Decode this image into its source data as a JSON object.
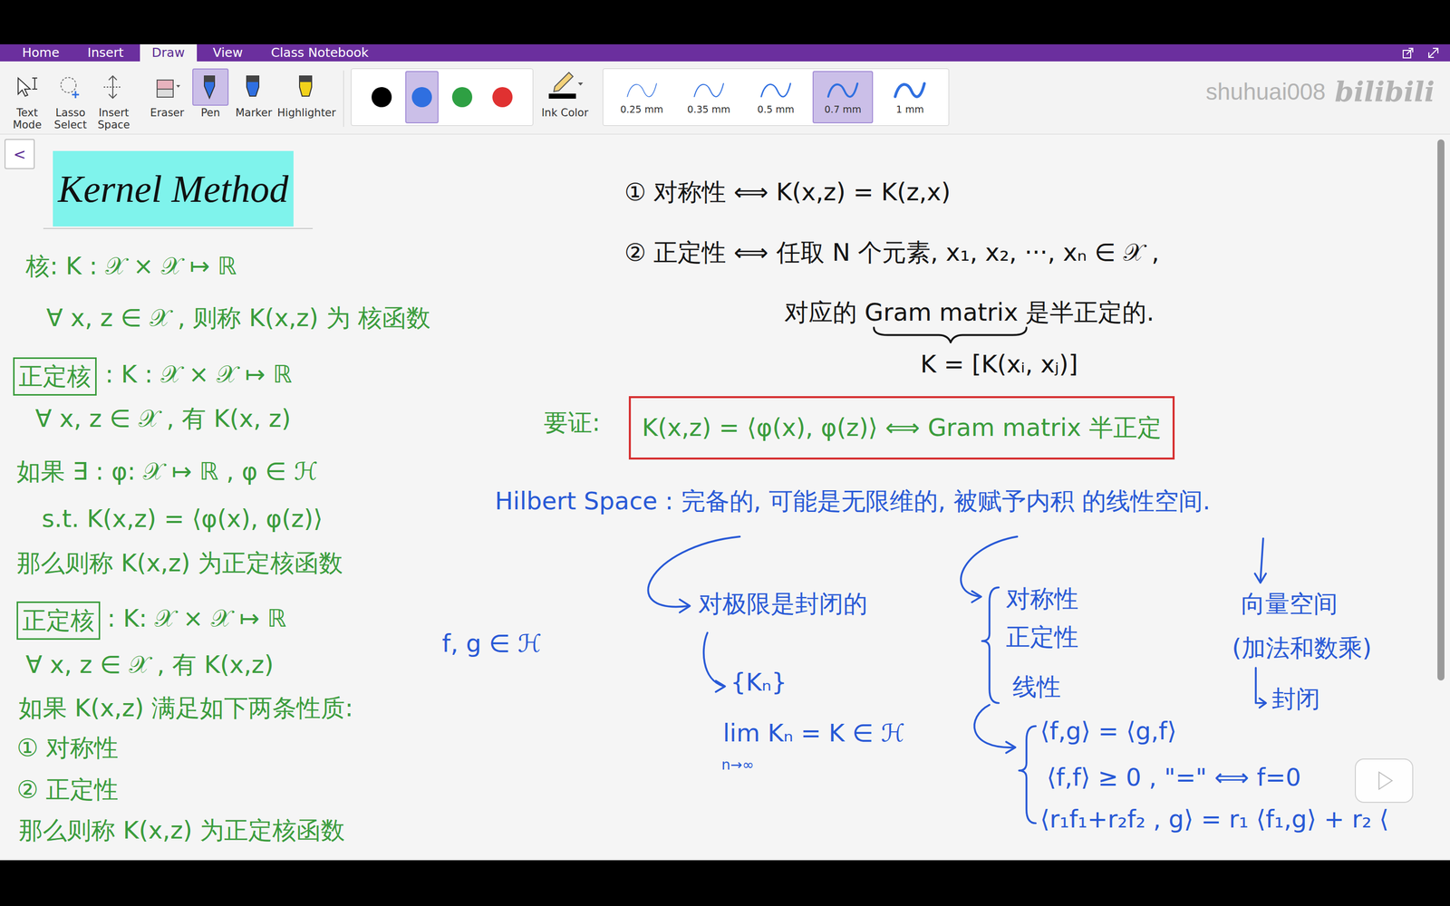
{
  "ribbon": {
    "tabs": [
      {
        "label": "Home",
        "selected": false
      },
      {
        "label": "Insert",
        "selected": false
      },
      {
        "label": "Draw",
        "selected": true
      },
      {
        "label": "View",
        "selected": false
      },
      {
        "label": "Class Notebook",
        "selected": false
      }
    ]
  },
  "toolbar": {
    "tools": [
      {
        "label": "Text Mode",
        "kind": "text-mode",
        "selected": false
      },
      {
        "label": "Lasso Select",
        "kind": "lasso",
        "selected": false
      },
      {
        "label": "Insert Space",
        "kind": "insert-space",
        "selected": false
      },
      {
        "label": "Eraser",
        "kind": "eraser",
        "selected": false
      },
      {
        "label": "Pen",
        "kind": "pen",
        "selected": true
      },
      {
        "label": "Marker",
        "kind": "marker",
        "selected": false
      },
      {
        "label": "Highlighter",
        "kind": "highlighter",
        "selected": false
      }
    ],
    "pen_colors": [
      {
        "color": "#000000",
        "selected": false
      },
      {
        "color": "#2f6fe0",
        "selected": true
      },
      {
        "color": "#2ea043",
        "selected": false
      },
      {
        "color": "#e03131",
        "selected": false
      }
    ],
    "ink_color": {
      "label": "Ink Color"
    },
    "thickness": [
      {
        "label": "0.25 mm",
        "selected": false
      },
      {
        "label": "0.35 mm",
        "selected": false
      },
      {
        "label": "0.5 mm",
        "selected": false
      },
      {
        "label": "0.7 mm",
        "selected": true
      },
      {
        "label": "1 mm",
        "selected": false
      }
    ]
  },
  "watermark": {
    "user": "shuhuai008",
    "site": "bilibili"
  },
  "page": {
    "back": "<",
    "title": "Kernel Method",
    "notes": [
      {
        "text": "核:  K : 𝒳 × 𝒳 ↦ ℝ",
        "color": "#3a9c3c",
        "kind": "text"
      },
      {
        "text": "∀ x, z ∈ 𝒳 , 则称 K(x,z) 为 核函数",
        "color": "#3a9c3c",
        "kind": "text"
      },
      {
        "text": "正定核",
        "color": "#3a9c3c",
        "kind": "boxed"
      },
      {
        "text": ": K : 𝒳 × 𝒳 ↦ ℝ",
        "color": "#3a9c3c",
        "kind": "text"
      },
      {
        "text": "∀ x, z ∈ 𝒳 , 有 K(x, z)",
        "color": "#3a9c3c",
        "kind": "text"
      },
      {
        "text": "如果 ∃ : φ: 𝒳 ↦ ℝ , φ ∈ ℋ",
        "color": "#3a9c3c",
        "kind": "text"
      },
      {
        "text": "s.t.  K(x,z) = ⟨φ(x), φ(z)⟩",
        "color": "#3a9c3c",
        "kind": "text"
      },
      {
        "text": "那么则称 K(x,z) 为正定核函数",
        "color": "#3a9c3c",
        "kind": "text"
      },
      {
        "text": "正定核",
        "color": "#3a9c3c",
        "kind": "boxed"
      },
      {
        "text": ": K: 𝒳 × 𝒳 ↦ ℝ",
        "color": "#3a9c3c",
        "kind": "text"
      },
      {
        "text": "∀ x, z ∈ 𝒳 , 有 K(x,z)",
        "color": "#3a9c3c",
        "kind": "text"
      },
      {
        "text": "如果 K(x,z) 满足如下两条性质:",
        "color": "#3a9c3c",
        "kind": "text"
      },
      {
        "text": "① 对称性",
        "color": "#3a9c3c",
        "kind": "text"
      },
      {
        "text": "② 正定性",
        "color": "#3a9c3c",
        "kind": "text"
      },
      {
        "text": "那么则称 K(x,z) 为正定核函数",
        "color": "#3a9c3c",
        "kind": "text"
      },
      {
        "text": "① 对称性 ⟺ K(x,z) = K(z,x)",
        "color": "#141414",
        "kind": "text"
      },
      {
        "text": "② 正定性 ⟺ 任取 N 个元素, x₁, x₂, ···, xₙ ∈ 𝒳 ,",
        "color": "#141414",
        "kind": "text"
      },
      {
        "text": "对应的 Gram matrix 是半正定的.",
        "color": "#141414",
        "kind": "text"
      },
      {
        "text": "K = [K(xᵢ, xⱼ)]",
        "color": "#141414",
        "kind": "text"
      },
      {
        "text": "要证:",
        "color": "#3a9c3c",
        "kind": "text"
      },
      {
        "text": "K(x,z) = ⟨φ(x), φ(z)⟩  ⟺  Gram matrix 半正定",
        "color": "#3a9c3c",
        "kind": "framed"
      },
      {
        "text": "Hilbert Space : 完备的, 可能是无限维的, 被赋予内积 的线性空间.",
        "color": "#2859d6",
        "kind": "text"
      },
      {
        "text": "对极限是封闭的",
        "color": "#2859d6",
        "kind": "text"
      },
      {
        "text": "{Kₙ}",
        "color": "#2859d6",
        "kind": "text"
      },
      {
        "text": "lim Kₙ = K ∈ ℋ",
        "color": "#2859d6",
        "kind": "text"
      },
      {
        "text": "n→∞",
        "color": "#2859d6",
        "kind": "small"
      },
      {
        "text": "f, g ∈ ℋ",
        "color": "#2859d6",
        "kind": "text"
      },
      {
        "text": "对称性",
        "color": "#2859d6",
        "kind": "text"
      },
      {
        "text": "正定性",
        "color": "#2859d6",
        "kind": "text"
      },
      {
        "text": "线性",
        "color": "#2859d6",
        "kind": "text"
      },
      {
        "text": "⟨f,g⟩ = ⟨g,f⟩",
        "color": "#2859d6",
        "kind": "text"
      },
      {
        "text": "⟨f,f⟩ ≥ 0 , \"=\" ⟺ f=0",
        "color": "#2859d6",
        "kind": "text"
      },
      {
        "text": "⟨r₁f₁+r₂f₂ , g⟩ = r₁ ⟨f₁,g⟩ + r₂ ⟨",
        "color": "#2859d6",
        "kind": "text"
      },
      {
        "text": "向量空间",
        "color": "#2859d6",
        "kind": "text"
      },
      {
        "text": "(加法和数乘)",
        "color": "#2859d6",
        "kind": "text"
      },
      {
        "text": "封闭",
        "color": "#2859d6",
        "kind": "text"
      }
    ]
  }
}
